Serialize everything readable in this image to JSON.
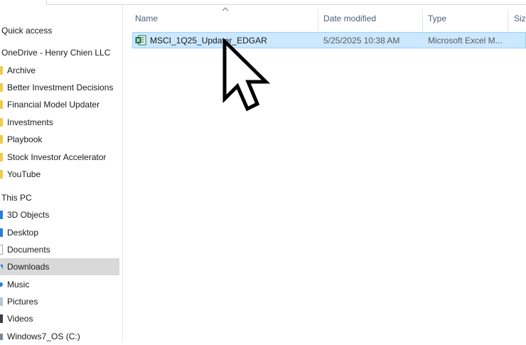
{
  "navigation": {
    "items": [
      {
        "label": "Quick access",
        "kind": "section",
        "icon": "",
        "selected": false
      },
      {
        "label": "OneDrive - Henry Chien LLC",
        "kind": "section",
        "icon": "onedrive-icon",
        "selected": false
      },
      {
        "label": "Archive",
        "kind": "child",
        "icon": "folder-icon",
        "selected": false
      },
      {
        "label": "Better Investment Decisions",
        "kind": "child",
        "icon": "folder-icon",
        "selected": false
      },
      {
        "label": "Financial Model Updater",
        "kind": "child",
        "icon": "folder-icon",
        "selected": false
      },
      {
        "label": "Investments",
        "kind": "child",
        "icon": "folder-icon",
        "selected": false
      },
      {
        "label": "Playbook",
        "kind": "child",
        "icon": "folder-icon",
        "selected": false
      },
      {
        "label": "Stock Investor Accelerator",
        "kind": "child",
        "icon": "folder-icon",
        "selected": false
      },
      {
        "label": "YouTube",
        "kind": "child",
        "icon": "folder-icon",
        "selected": false
      },
      {
        "label": "This PC",
        "kind": "section",
        "icon": "pc-icon",
        "selected": false
      },
      {
        "label": "3D Objects",
        "kind": "child",
        "icon": "3d-objects-icon",
        "selected": false
      },
      {
        "label": "Desktop",
        "kind": "child",
        "icon": "desktop-icon",
        "selected": false
      },
      {
        "label": "Documents",
        "kind": "child",
        "icon": "documents-icon",
        "selected": false
      },
      {
        "label": "Downloads",
        "kind": "child",
        "icon": "downloads-icon",
        "selected": true
      },
      {
        "label": "Music",
        "kind": "child",
        "icon": "music-icon",
        "selected": false
      },
      {
        "label": "Pictures",
        "kind": "child",
        "icon": "pictures-icon",
        "selected": false
      },
      {
        "label": "Videos",
        "kind": "child",
        "icon": "videos-icon",
        "selected": false
      },
      {
        "label": "Windows7_OS (C:)",
        "kind": "child",
        "icon": "drive-icon",
        "selected": false
      }
    ]
  },
  "columns": {
    "name": "Name",
    "date_modified": "Date modified",
    "type": "Type",
    "size": "Size"
  },
  "files": [
    {
      "name": "MSCI_1Q25_Updater_EDGAR",
      "date_modified": "5/25/2025 10:38 AM",
      "type": "Microsoft Excel M...",
      "icon": "excel-icon",
      "selected": true
    }
  ],
  "colors": {
    "selection_bg": "#cce8ff",
    "selection_border": "#99d1ff",
    "nav_selected_bg": "#d9d9d9",
    "header_text": "#4c607a",
    "folder": "#f2c94c",
    "excel_green": "#1d6f42"
  }
}
